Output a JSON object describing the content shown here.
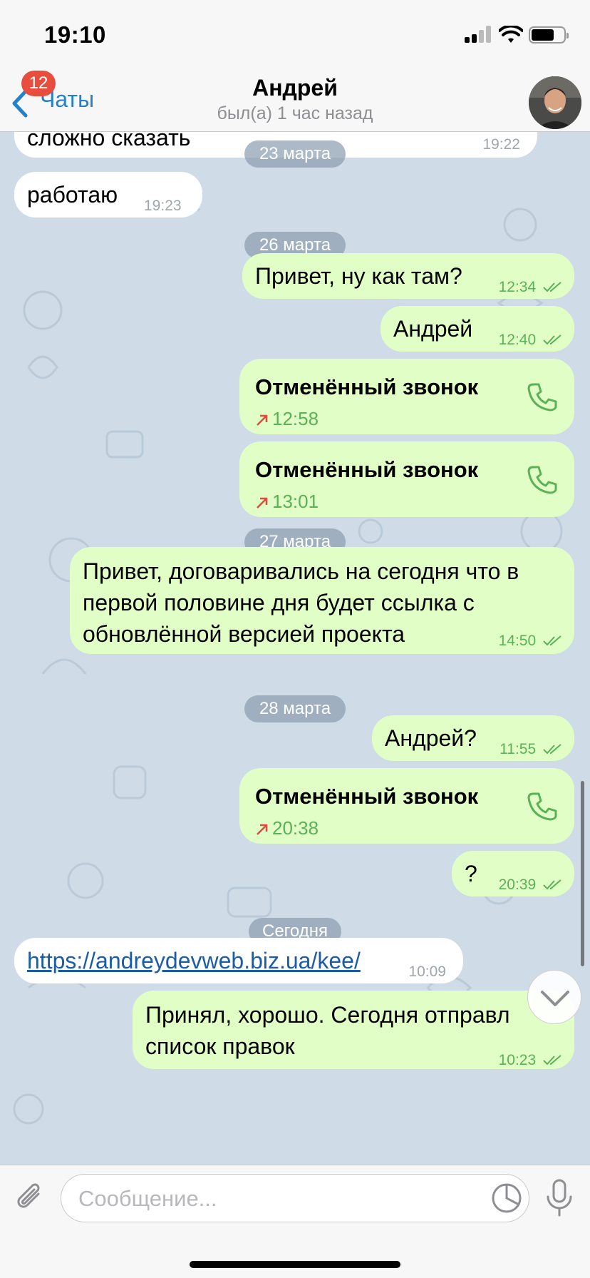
{
  "status_bar": {
    "time": "19:10"
  },
  "nav": {
    "back_label": "Чаты",
    "unread_count": "12",
    "contact_name": "Андрей",
    "contact_status": "был(а) 1 час назад"
  },
  "messages": {
    "m1": {
      "text": "сложно сказать",
      "time": "19:22"
    },
    "m2": {
      "text": "работаю",
      "time": "19:23"
    },
    "d1": "23 марта",
    "d2": "26 марта",
    "m3": {
      "text": "Привет, ну как там?",
      "time": "12:34"
    },
    "m4": {
      "text": "Андрей",
      "time": "12:40"
    },
    "c1": {
      "title": "Отменённый звонок",
      "time": "12:58"
    },
    "c2": {
      "title": "Отменённый звонок",
      "time": "13:01"
    },
    "d3": "27 марта",
    "m5": {
      "line1": "Привет, договаривались на сегодня что в",
      "line2": "первой половине дня будет ссылка с",
      "line3": "обновлённой версией проекта",
      "time": "14:50"
    },
    "d4": "28 марта",
    "m6": {
      "text": "Андрей?",
      "time": "11:55"
    },
    "c3": {
      "title": "Отменённый звонок",
      "time": "20:38"
    },
    "m7": {
      "text": "?",
      "time": "20:39"
    },
    "d5": "Сегодня",
    "m8": {
      "text": "https://andreydevweb.biz.ua/kee/",
      "time": "10:09"
    },
    "m9": {
      "line1": "Принял, хорошо. Сегодня отправл",
      "line2": "список правок",
      "time": "10:23"
    }
  },
  "input": {
    "placeholder": "Сообщение..."
  },
  "colors": {
    "accent": "#2481cc",
    "outgoing_bubble": "#e1fec6",
    "incoming_bubble": "#ffffff",
    "chat_bg": "#cfdbe6",
    "badge": "#e84e3e",
    "missed_call_arrow": "#e5483f"
  },
  "icons": [
    "back-chevron-icon",
    "phone-icon",
    "read-ticks-icon",
    "call-outgoing-arrow-icon",
    "paperclip-icon",
    "sticker-icon",
    "microphone-icon",
    "chevron-down-icon",
    "wifi-icon",
    "battery-icon",
    "signal-icon"
  ]
}
